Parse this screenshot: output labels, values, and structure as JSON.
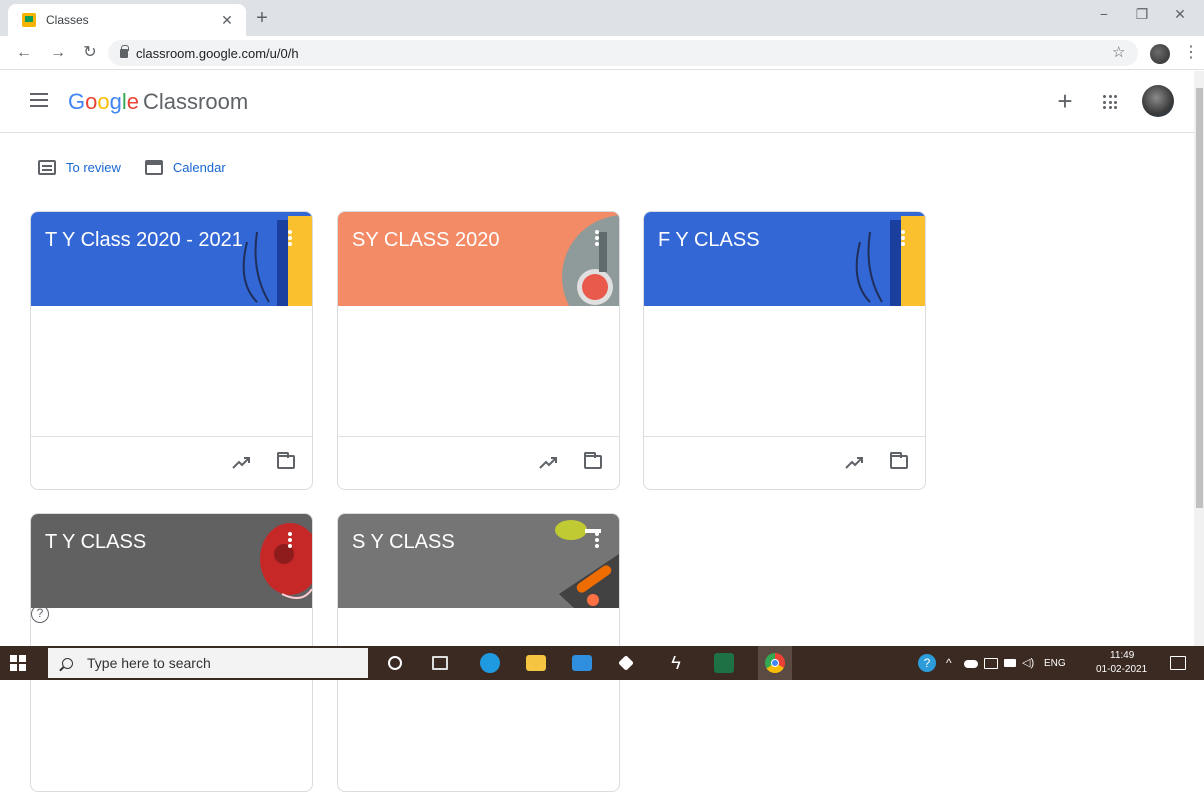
{
  "browser": {
    "tab_title": "Classes",
    "url": "classroom.google.com/u/0/h"
  },
  "app": {
    "logo_google": [
      "G",
      "o",
      "o",
      "g",
      "l",
      "e"
    ],
    "logo_product": "Classroom"
  },
  "subnav": {
    "to_review": "To review",
    "calendar": "Calendar"
  },
  "classes": [
    {
      "name": "T Y Class 2020 - 2021",
      "color": "#3367d6"
    },
    {
      "name": "SY CLASS 2020",
      "color": "#f28b66"
    },
    {
      "name": "F Y CLASS",
      "color": "#3367d6"
    },
    {
      "name": "T Y CLASS",
      "color": "#616161"
    },
    {
      "name": "S Y CLASS",
      "color": "#757575"
    }
  ],
  "taskbar": {
    "search_placeholder": "Type here to search",
    "language": "ENG",
    "time": "11:49",
    "date": "01-02-2021"
  }
}
